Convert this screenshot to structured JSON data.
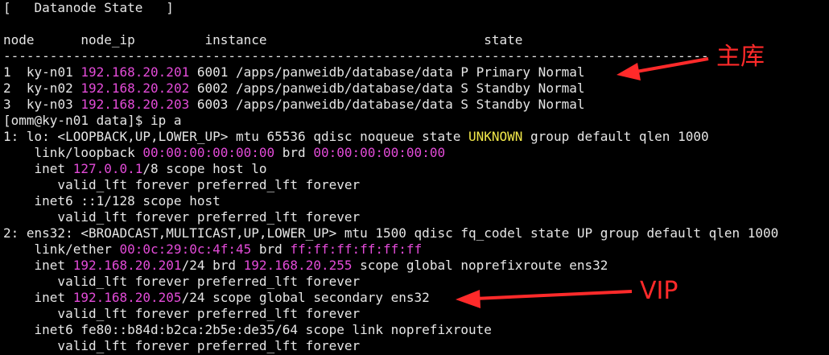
{
  "header": {
    "title_line": "[   Datanode State   ]",
    "columns_line": "node      node_ip         instance                            state",
    "separator": "-------------------------------------------------------------------------------------------"
  },
  "datanodes": [
    {
      "num": "1",
      "node": "ky-n01",
      "ip": "192.168.20.201",
      "rest": " 6001 /apps/panweidb/database/data P Primary Normal"
    },
    {
      "num": "2",
      "node": "ky-n02",
      "ip": "192.168.20.202",
      "rest": " 6002 /apps/panweidb/database/data S Standby Normal"
    },
    {
      "num": "3",
      "node": "ky-n03",
      "ip": "192.168.20.203",
      "rest": " 6003 /apps/panweidb/database/data S Standby Normal"
    }
  ],
  "prompt": {
    "text": "[omm@ky-n01 data]$ ip a"
  },
  "interfaces": {
    "lo": {
      "header_a": "1: lo: <LOOPBACK,UP,LOWER_UP> mtu 65536 qdisc noqueue state ",
      "state": "UNKNOWN",
      "header_b": " group default qlen 1000",
      "link_label": "    link/loopback ",
      "mac": "00:00:00:00:00:00",
      "brd_label": " brd ",
      "brd_mac": "00:00:00:00:00:00",
      "inet_label": "    inet ",
      "inet_ip": "127.0.0.1",
      "inet_rest": "/8 scope host lo",
      "valid1": "       valid_lft forever preferred_lft forever",
      "inet6": "    inet6 ::1/128 scope host",
      "valid2": "       valid_lft forever preferred_lft forever"
    },
    "ens32": {
      "header": "2: ens32: <BROADCAST,MULTICAST,UP,LOWER_UP> mtu 1500 qdisc fq_codel state UP group default qlen 1000",
      "link_label": "    link/ether ",
      "mac": "00:0c:29:0c:4f:45",
      "brd_label": " brd ",
      "brd_mac": "ff:ff:ff:ff:ff:ff",
      "inet1_label": "    inet ",
      "inet1_ip": "192.168.20.201",
      "inet1_mid": "/24 brd ",
      "inet1_brd": "192.168.20.255",
      "inet1_rest": " scope global noprefixroute ens32",
      "valid1": "       valid_lft forever preferred_lft forever",
      "inet2_label": "    inet ",
      "inet2_ip": "192.168.20.205",
      "inet2_rest": "/24 scope global secondary ens32",
      "valid2": "       valid_lft forever preferred_lft forever",
      "inet6": "    inet6 fe80::b84d:b2ca:2b5e:de35/64 scope link noprefixroute",
      "valid3": "       valid_lft forever preferred_lft forever"
    }
  },
  "annotations": {
    "primary_label": "主库",
    "vip_label": "VIP",
    "color": "#ff2a2a"
  },
  "colors": {
    "background": "#000000",
    "text": "#e6e6e6",
    "ip_magenta": "#e34bd8",
    "state_yellow": "#f2e84a"
  }
}
